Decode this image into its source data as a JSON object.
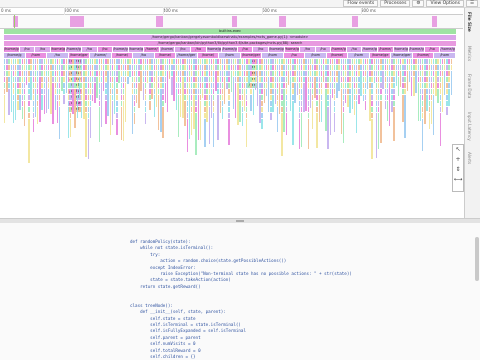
{
  "toolbar": {
    "buttons": [
      {
        "label": "Flow events"
      },
      {
        "label": "Processes"
      },
      {
        "label": "⚙"
      },
      {
        "label": "View Options"
      },
      {
        "label": "☰"
      }
    ]
  },
  "ruler": {
    "ticks": [
      "0 ms",
      "200 ms",
      "400 ms",
      "600 ms",
      "800 ms"
    ]
  },
  "flame": {
    "row0": "builtins.exec",
    "row1": "/home/gergo/kanban/gergelyzsomboldkaewinatu/examples/mcts_game.py(1): <module>",
    "row2": "/home/gergo/kanban/bin/python3/lib/python3.6/site-packages/mcts.py(88): search",
    "row3_labels": [
      "/home/gerg",
      "/ho",
      "/ho",
      "/home/gergo/ki",
      "/home/g",
      "/ho",
      "/ho",
      "/home/gergelyzs",
      "/home/ger",
      "/home/",
      "/home/",
      "/ho",
      "/ho",
      "/home/ge",
      "/home/gergelyzs",
      "/ho",
      "/ho",
      "/home/gergelyzs",
      "/home/gerg",
      "/ho",
      "/ho",
      "/home/ge",
      "/ho",
      "/home/gergelyzs",
      "/home/",
      "/home/ger",
      "/home/gerg",
      "/ho",
      "/home/ge"
    ],
    "row4_labels": [
      "/home/g",
      "/hom",
      "/ho",
      "/home/ger",
      "/home/",
      "/home/",
      "/ho",
      "/home/",
      "/home/ger",
      "/home/",
      "/hom",
      "/home/ger",
      "/hom",
      "/ho",
      "/hom",
      "/home/",
      "/hom",
      "/home/ge",
      "/home/ger",
      "/home/",
      "/hom"
    ],
    "deep_labels": [
      "/home/",
      "/carRe",
      "/carRe",
      "/carRe",
      "/carT",
      "/carRe",
      "/carT",
      "/carRe",
      "/carT"
    ],
    "right_labels": [
      "/ho",
      "/car",
      "/car",
      "/car",
      "/car"
    ]
  },
  "sidetabs": [
    {
      "label": "File Size"
    },
    {
      "label": "Metrics"
    },
    {
      "label": "Frame Data"
    },
    {
      "label": "Input Latency"
    },
    {
      "label": "Alerts"
    }
  ],
  "tools": [
    {
      "icon": "select-icon",
      "glyph": "↖"
    },
    {
      "icon": "zoom-icon",
      "glyph": "+"
    },
    {
      "icon": "pan-icon",
      "glyph": "⇕"
    },
    {
      "icon": "timing-icon",
      "glyph": "⟷"
    }
  ],
  "code": {
    "lines": [
      "def randomPolicy(state):",
      "    while not state.isTerminal():",
      "        try:",
      "            action = random.choice(state.getPossibleActions())",
      "        except IndexError:",
      "            raise Exception(\"Non-terminal state has no possible actions: \" + str(state))",
      "        state = state.takeAction(action)",
      "    return state.getReward()",
      "",
      "",
      "class treeNode():",
      "    def __init__(self, state, parent):",
      "        self.state = state",
      "        self.isTerminal = state.isTerminal()",
      "        self.isFullyExpanded = self.isTerminal",
      "        self.parent = parent",
      "        self.numVisits = 0",
      "        self.totalReward = 0",
      "        self.children = {}"
    ]
  },
  "colors": {
    "exec": "#9fe3a3",
    "module": "#dba6ea",
    "search": "#e89ae0",
    "pink": "#e98fe0",
    "lavender": "#c9b7f0",
    "mint": "#a9ecbf",
    "peach": "#f2c29c",
    "yellow": "#f3e7a2",
    "blue": "#a6d0f2",
    "cyan": "#9be6ea"
  }
}
